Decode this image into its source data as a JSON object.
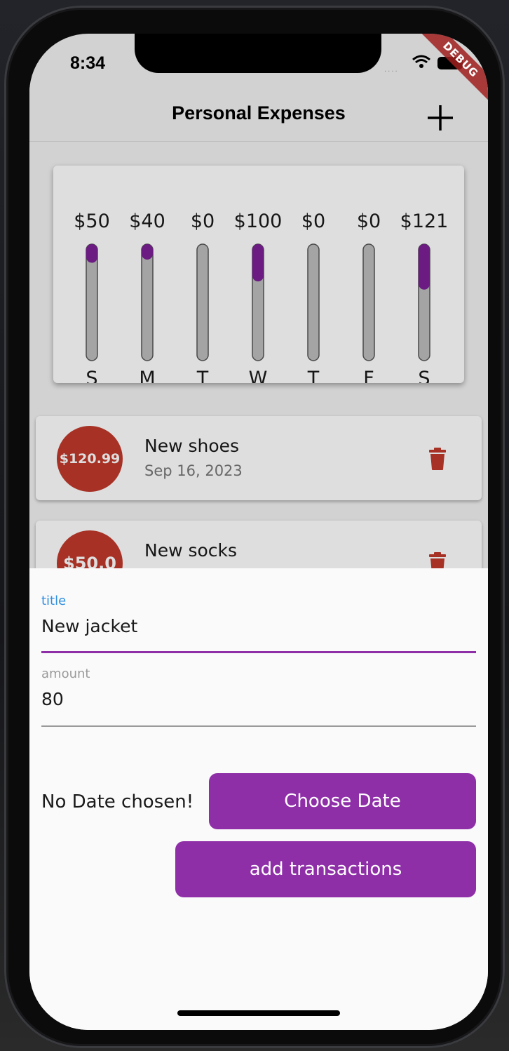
{
  "status_bar": {
    "time": "8:34",
    "cell_dots": "....",
    "debug_label": "DEBUG"
  },
  "app_bar": {
    "title": "Personal Expenses",
    "add_icon": "plus-icon"
  },
  "chart_data": {
    "type": "bar",
    "categories": [
      "S",
      "M",
      "T",
      "W",
      "T",
      "F",
      "S"
    ],
    "values": [
      50,
      40,
      0,
      100,
      0,
      0,
      121
    ],
    "value_labels": [
      "$50",
      "$40",
      "$0",
      "$100",
      "$0",
      "$0",
      "$121"
    ],
    "fill_fractions": [
      0.16,
      0.13,
      0,
      0.32,
      0,
      0,
      0.39
    ],
    "colors": {
      "fill": "#7b1f96",
      "track": "#bdbdbd"
    }
  },
  "transactions": [
    {
      "amount": "$120.99",
      "title": "New shoes",
      "date": "Sep 16, 2023"
    },
    {
      "amount": "$50.0",
      "title": "New socks",
      "date": ""
    }
  ],
  "form": {
    "title_label": "title",
    "title_value": "New jacket",
    "amount_label": "amount",
    "amount_value": "80",
    "date_status": "No Date chosen!",
    "choose_date_label": "Choose Date",
    "submit_label": "add transactions"
  },
  "colors": {
    "accent": "#8e2fa8",
    "label_focused": "#2f8fe0",
    "danger": "#c0392b"
  }
}
